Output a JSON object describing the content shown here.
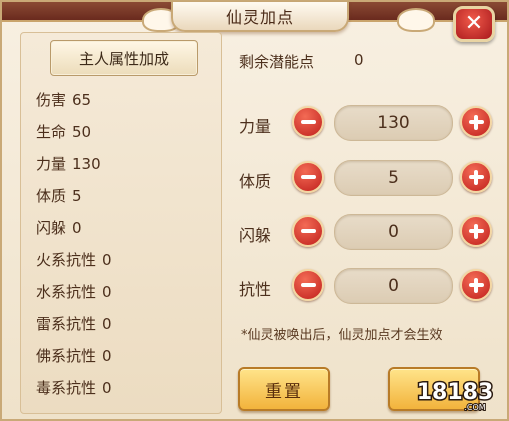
{
  "window": {
    "title": "仙灵加点",
    "close_icon": "close-icon"
  },
  "attributes": {
    "header": "主人属性加成",
    "rows": [
      {
        "label": "伤害",
        "value": "65"
      },
      {
        "label": "生命",
        "value": "50"
      },
      {
        "label": "力量",
        "value": "130"
      },
      {
        "label": "体质",
        "value": "5"
      },
      {
        "label": "闪躲",
        "value": "0"
      },
      {
        "label": "火系抗性",
        "value": "0"
      },
      {
        "label": "水系抗性",
        "value": "0"
      },
      {
        "label": "雷系抗性",
        "value": "0"
      },
      {
        "label": "佛系抗性",
        "value": "0"
      },
      {
        "label": "毒系抗性",
        "value": "0"
      }
    ]
  },
  "allocation": {
    "remaining_label": "剩余潜能点",
    "remaining_value": "0",
    "stats": [
      {
        "label": "力量",
        "value": "130"
      },
      {
        "label": "体质",
        "value": "5"
      },
      {
        "label": "闪躲",
        "value": "0"
      },
      {
        "label": "抗性",
        "value": "0"
      }
    ],
    "hint": "*仙灵被唤出后，仙灵加点才会生效"
  },
  "buttons": {
    "reset": "重置",
    "confirm": ""
  },
  "watermark": {
    "text": "18183",
    "sub": ".COM"
  },
  "colors": {
    "accent_red": "#c01f1c",
    "button_gold": "#f2b33c",
    "text_brown": "#4c2f1c",
    "panel_bg": "#f8f0e2"
  }
}
